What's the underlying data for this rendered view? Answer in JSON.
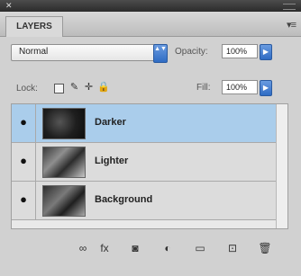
{
  "panel": {
    "close_glyph": "✕",
    "tab_label": "LAYERS",
    "menu_glyph": "▾≡"
  },
  "controls": {
    "blend_mode": "Normal",
    "opacity_label": "Opacity:",
    "opacity_value": "100%",
    "lock_label": "Lock:",
    "fill_label": "Fill:",
    "fill_value": "100%",
    "spinner_glyph": "▲▼",
    "stepper_glyph": "▶"
  },
  "lock_icons": {
    "brush_glyph": "✎",
    "move_glyph": "✛",
    "lock_glyph": "🔒"
  },
  "layers": [
    {
      "name": "Darker",
      "selected": true,
      "visible_glyph": "●"
    },
    {
      "name": "Lighter",
      "selected": false,
      "visible_glyph": "●"
    },
    {
      "name": "Background",
      "selected": false,
      "visible_glyph": "●"
    }
  ],
  "toolbar": [
    {
      "name": "link-layers-icon",
      "glyph": "∞"
    },
    {
      "name": "layer-style-icon",
      "glyph": "fx"
    },
    {
      "name": "layer-mask-icon",
      "glyph": "◙"
    },
    {
      "name": "adjustment-layer-icon",
      "glyph": "◐"
    },
    {
      "name": "new-group-icon",
      "glyph": "▭"
    },
    {
      "name": "new-layer-icon",
      "glyph": "⊡"
    },
    {
      "name": "delete-layer-icon",
      "glyph": "🗑"
    }
  ],
  "colors": {
    "selected_row": "#aacdeb",
    "accent": "#2f6cc4"
  }
}
